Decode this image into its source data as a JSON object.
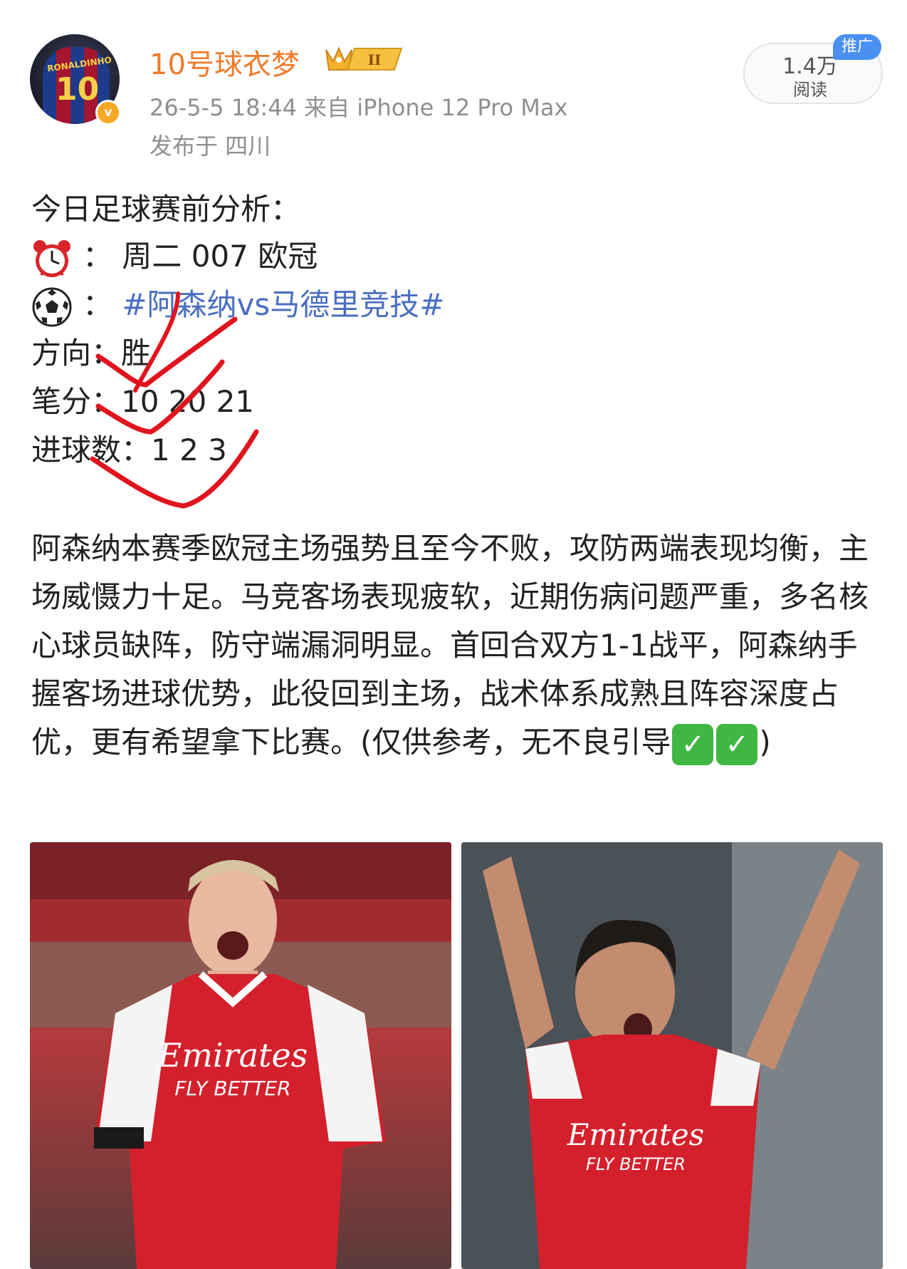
{
  "user": {
    "name": "10号球衣梦",
    "avatar_name_text": "RONALDINHO",
    "avatar_number": "10",
    "level_badge": "II",
    "verified_icon": "verified-v-icon",
    "meta": "26-5-5 18:44  来自 iPhone 12 Pro Max",
    "location": "发布于 四川"
  },
  "stats": {
    "read_count": "1.4万",
    "read_label": "阅读",
    "promo_tag": "推广"
  },
  "post": {
    "heading": "今日足球赛前分析：",
    "line_time_icon": "alarm-clock-icon",
    "line_time": "：  周二 007 欧冠",
    "line_match_icon": "soccer-ball-icon",
    "line_match_prefix": "：  ",
    "line_match_hashtag": "#阿森纳vs马德里竞技#",
    "line_direction": "方向：胜",
    "line_score": "笔分：10 20 21",
    "line_goals": "进球数：1 2 3",
    "paragraph_main": "阿森纳本赛季欧冠主场强势且至今不败，攻防两端表现均衡，主场威慑力十足。马竞客场表现疲软，近期伤病问题严重，多名核心球员缺阵，防守端漏洞明显。首回合双方1-1战平，阿森纳手握客场进球优势，此役回到主场，战术体系成熟且阵容深度占优，更有希望拿下比赛。(仅供参考，无不良引导",
    "check1": "✓",
    "check2": "✓",
    "paragraph_end": ")"
  },
  "photos": {
    "left_jersey_brand": "Emirates",
    "left_jersey_slogan": "FLY BETTER",
    "right_jersey_brand": "Emirates",
    "right_jersey_slogan": "FLY BETTER"
  },
  "colors": {
    "username": "#f07b2a",
    "hashtag": "#4a6ec0",
    "red_marks": "#e0141e",
    "promo": "#4a8ff2",
    "arsenal_red": "#d4202c"
  }
}
